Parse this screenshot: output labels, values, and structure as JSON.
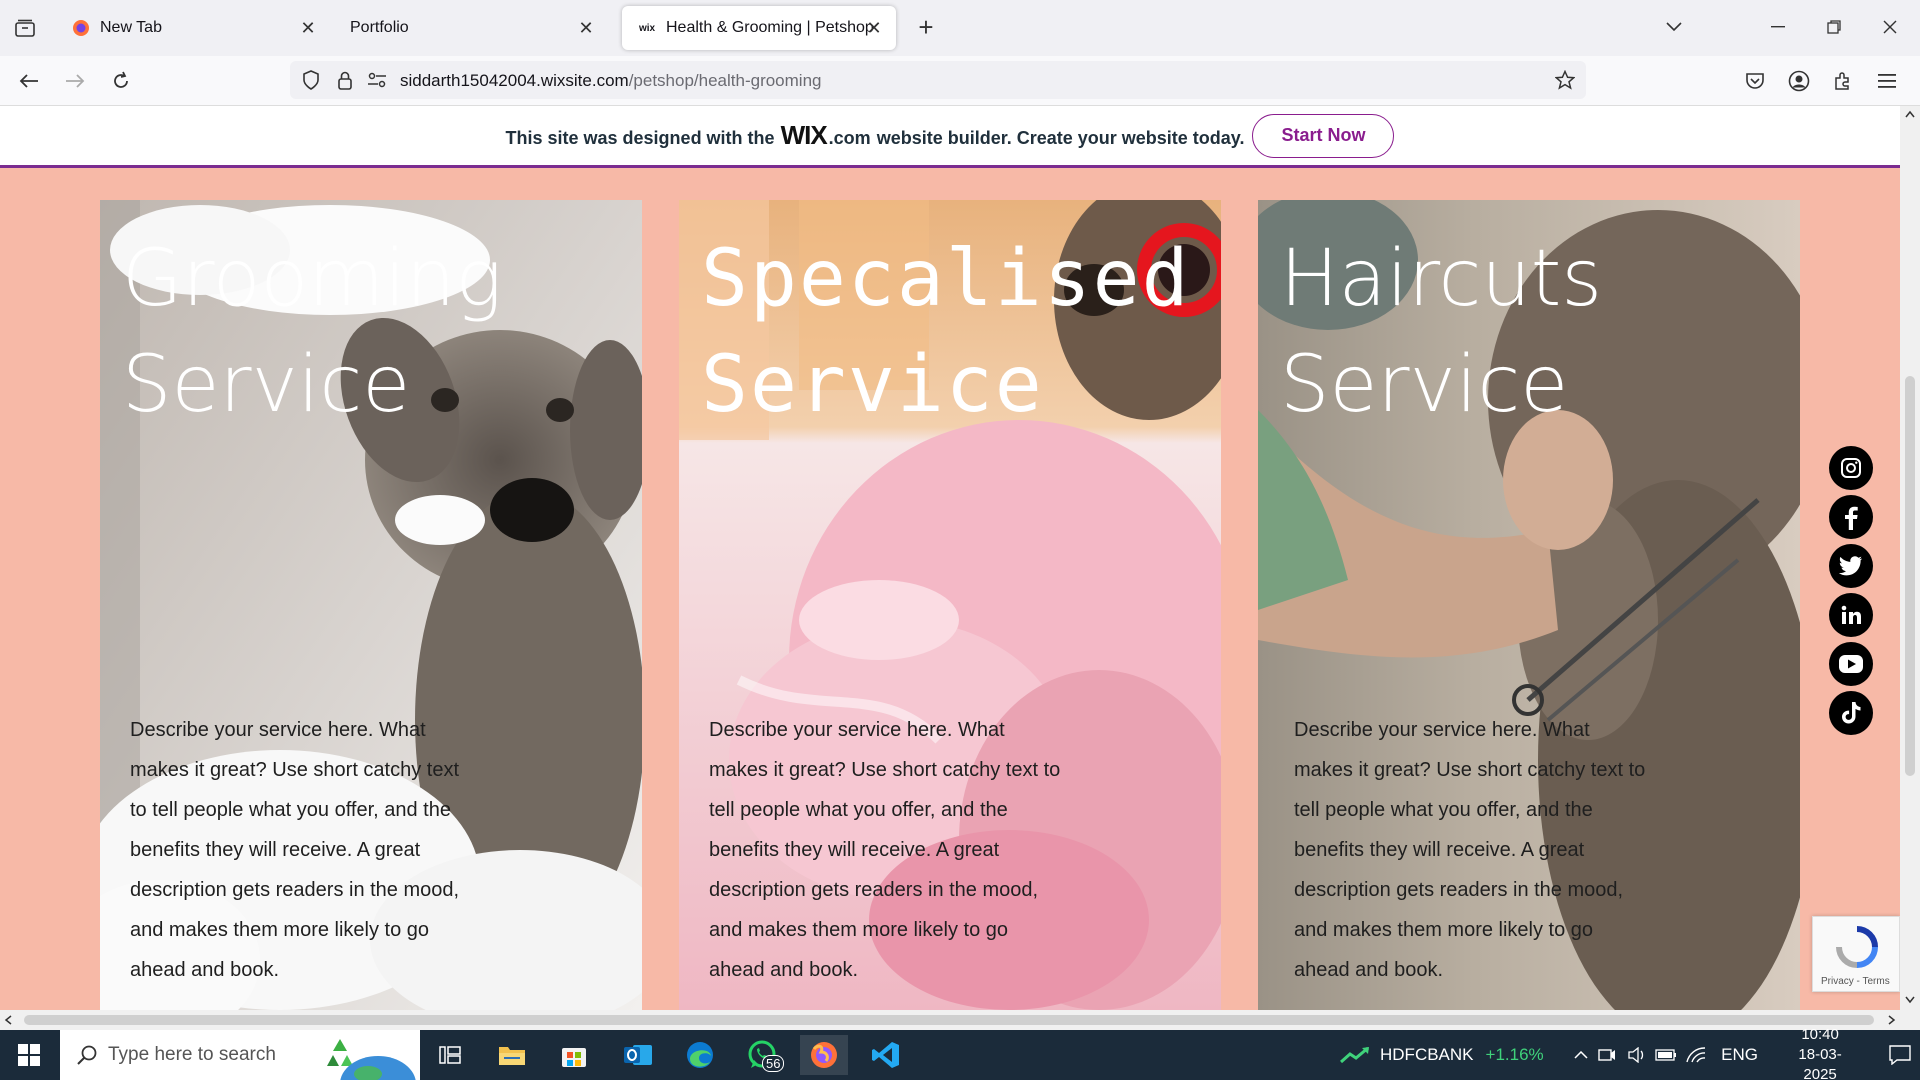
{
  "browser": {
    "tabs": [
      {
        "label": "New Tab",
        "active": false
      },
      {
        "label": "Portfolio",
        "active": false
      },
      {
        "label": "Health & Grooming | Petshop",
        "active": true
      }
    ],
    "url_host": "siddarth15042004.wixsite.com",
    "url_path": "/petshop/health-grooming"
  },
  "wix_banner": {
    "text_before": "This site was designed with the",
    "logo": "WIX",
    "logo_suffix": ".com",
    "text_after": "website builder. Create your website today.",
    "button": "Start Now"
  },
  "cards": [
    {
      "title_line1": "Grooming",
      "title_line2": "Service",
      "description": "Describe your service here. What makes it great? Use short catchy text to tell people what you offer, and the benefits they will receive. A great description gets readers in the mood, and makes them more likely to go ahead and book."
    },
    {
      "title_line1": "Specalised",
      "title_line2": "Service",
      "description": "Describe your service here. What makes it great? Use short catchy text to tell people what you offer, and the benefits they will receive. A great description gets readers in the mood, and makes them more likely to go ahead and book."
    },
    {
      "title_line1": "Haircuts",
      "title_line2": "Service",
      "description": "Describe your service here. What makes it great? Use short catchy text to tell people what you offer, and the benefits they will receive. A great description gets readers in the mood, and makes them more likely to go ahead and book."
    }
  ],
  "socials": [
    "instagram-icon",
    "facebook-icon",
    "twitter-icon",
    "linkedin-icon",
    "youtube-icon",
    "tiktok-icon"
  ],
  "recaptcha": {
    "links": "Privacy - Terms"
  },
  "taskbar": {
    "search_placeholder": "Type here to search",
    "whatsapp_badge": "56",
    "stock_name": "HDFCBANK",
    "stock_change": "+1.16%",
    "language": "ENG",
    "time": "10:40",
    "date": "18-03-2025"
  },
  "colors": {
    "page_bg": "#f7b9a7",
    "wix_accent": "#8a1d8e",
    "stock_green": "#3fd27b"
  }
}
